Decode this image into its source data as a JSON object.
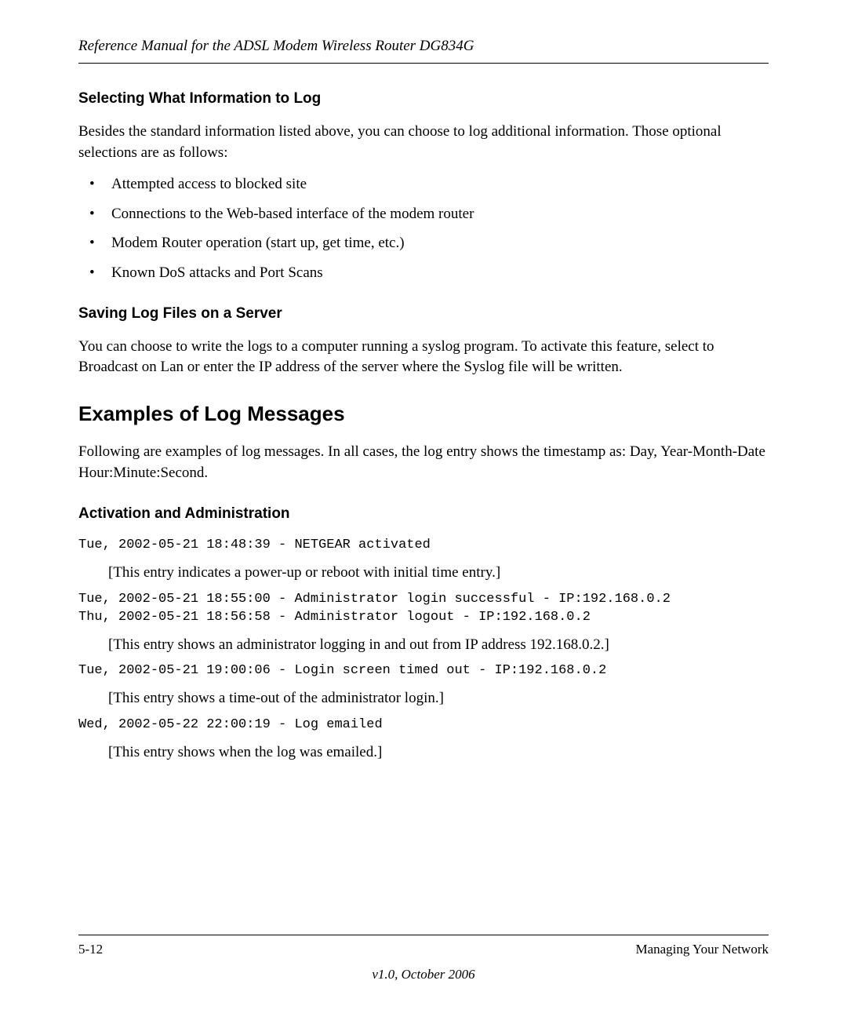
{
  "header": {
    "title": "Reference Manual for the ADSL Modem Wireless Router DG834G"
  },
  "section1": {
    "heading": "Selecting What Information to Log",
    "intro": "Besides the standard information listed above, you can choose to log additional information. Those optional selections are as follows:",
    "bullets": [
      "Attempted access to blocked site",
      "Connections to the Web-based interface of the modem router",
      "Modem Router operation (start up, get time, etc.)",
      "Known DoS attacks and Port Scans"
    ]
  },
  "section2": {
    "heading": "Saving Log Files on a Server",
    "body": "You can choose to write the logs to a computer running a syslog program. To activate this feature, select to Broadcast on Lan or enter the IP address of the server where the Syslog file will be written."
  },
  "section3": {
    "heading": "Examples of Log Messages",
    "intro": "Following are examples of log messages. In all cases, the log entry shows the timestamp as:   Day, Year-Month-Date  Hour:Minute:Second."
  },
  "section4": {
    "heading": "Activation and Administration",
    "log1": "Tue, 2002-05-21 18:48:39 - NETGEAR activated ",
    "explain1": "[This entry indicates a power-up or reboot with initial time entry.]",
    "log2": "Tue, 2002-05-21 18:55:00 - Administrator login successful - IP:192.168.0.2 \nThu, 2002-05-21 18:56:58 - Administrator logout - IP:192.168.0.2 ",
    "explain2": "[This entry shows an administrator logging in and out from IP address 192.168.0.2.]",
    "log3": "Tue, 2002-05-21 19:00:06 - Login screen timed out - IP:192.168.0.2",
    "explain3": "[This entry shows a time-out of the administrator login.]",
    "log4": "Wed, 2002-05-22 22:00:19 - Log emailed",
    "explain4": "[This entry shows when the log was emailed.]"
  },
  "footer": {
    "page": "5-12",
    "chapter": "Managing Your Network",
    "version": "v1.0, October 2006"
  }
}
